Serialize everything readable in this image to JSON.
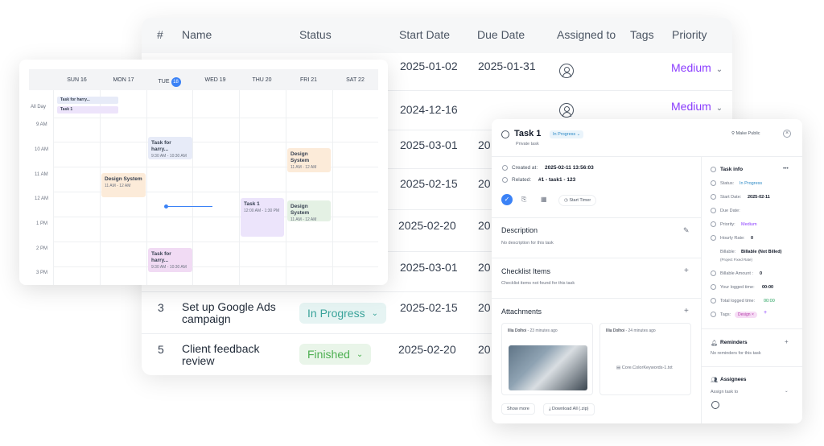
{
  "table": {
    "headers": {
      "num": "#",
      "name": "Name",
      "status": "Status",
      "start": "Start Date",
      "due": "Due Date",
      "assigned": "Assigned to",
      "tags": "Tags",
      "priority": "Priority"
    },
    "rows": [
      {
        "start": "2025-01-02",
        "due": "2025-01-31",
        "priority": "Medium"
      },
      {
        "start": "2024-12-16",
        "due": "",
        "priority": "Medium"
      },
      {
        "start": "2025-03-01",
        "due": "20"
      },
      {
        "start": "2025-02-15",
        "due": "20"
      },
      {
        "start": "2025-02-20",
        "due": "20"
      },
      {
        "start": "2025-03-01",
        "due": "20"
      },
      {
        "num": "3",
        "name": "Set up Google Ads campaign",
        "status": "In Progress",
        "start": "2025-02-15",
        "due": "20"
      },
      {
        "num": "5",
        "name": "Client feedback review",
        "status": "Finished",
        "start": "2025-02-20",
        "due": "20"
      }
    ],
    "colors": {
      "priority": "#8b3dff",
      "in_progress_bg": "#e6f4f3",
      "in_progress_text": "#3aa39a",
      "finished_bg": "#e9f5e9",
      "finished_text": "#4caf50"
    }
  },
  "calendar": {
    "days": [
      "SUN 16",
      "MON 17",
      "TUE",
      "WED 19",
      "THU 20",
      "FRI 21",
      "SAT 22"
    ],
    "today_num": "18",
    "times": [
      "All Day",
      "9 AM",
      "10 AM",
      "11 AM",
      "12 AM",
      "1 PM",
      "2 PM",
      "3 PM"
    ],
    "allday": [
      "Task for harry...",
      "Task 1"
    ],
    "events": [
      {
        "title": "Task for harry...",
        "time": "9:30 AM - 10:30 AM"
      },
      {
        "title": "Design System",
        "time": "11 AM - 12 AM"
      },
      {
        "title": "Design System",
        "time": "11 AM - 12 AM"
      },
      {
        "title": "Task 1",
        "time": "12:00 AM - 1:30 PM"
      },
      {
        "title": "Design System",
        "time": "11 AM - 12 AM"
      },
      {
        "title": "Task for harry...",
        "time": "9:30 AM - 10:30 AM"
      }
    ]
  },
  "task": {
    "title": "Task 1",
    "status": "In Progress",
    "subtitle": "Private task",
    "make_public": "Make Public",
    "created_label": "Created at:",
    "created_value": "2025-02-11 13:56:03",
    "related_label": "Related:",
    "related_value": "#1 - task1 - 123",
    "start_timer": "Start Timer",
    "description_title": "Description",
    "description_empty": "No description for this task",
    "checklist_title": "Checklist Items",
    "checklist_empty": "Checklist items not found for this task",
    "attachments_title": "Attachments",
    "attachment1_user": "Illia Dolhoi",
    "attachment1_time": "- 23 minutes ago",
    "attachment2_user": "Illia Dolhoi",
    "attachment2_time": "- 24 minutes ago",
    "attachment2_file": "Core.ColorKeywords-1.txt",
    "show_more": "Show more",
    "download_all": "Download All (.zip)",
    "info_title": "Task info",
    "info_more": "•••",
    "status_label": "Status:",
    "status_value": "In Progress",
    "start_label": "Start Date:",
    "start_value": "2025-02-11",
    "due_label": "Due Date:",
    "priority_label": "Priority:",
    "priority_value": "Medium",
    "hourly_label": "Hourly Rate:",
    "hourly_value": "0",
    "billable_label": "Billable:",
    "billable_value": "Billable (Not Billed)",
    "billable_sub": "(Project Fixed Rate)",
    "billable_amount_label": "Billable Amount :",
    "billable_amount_value": "0",
    "your_logged_label": "Your logged time:",
    "your_logged_value": "00:00",
    "total_logged_label": "Total logged time:",
    "total_logged_value": "00:00",
    "tags_label": "Tags:",
    "tag_value": "Design",
    "tag_remove": "×",
    "tag_add": "+",
    "reminders_title": "Reminders",
    "reminders_empty": "No reminders for this task",
    "assignees_title": "Assignees",
    "assign_placeholder": "Assign task to",
    "add": "+"
  }
}
